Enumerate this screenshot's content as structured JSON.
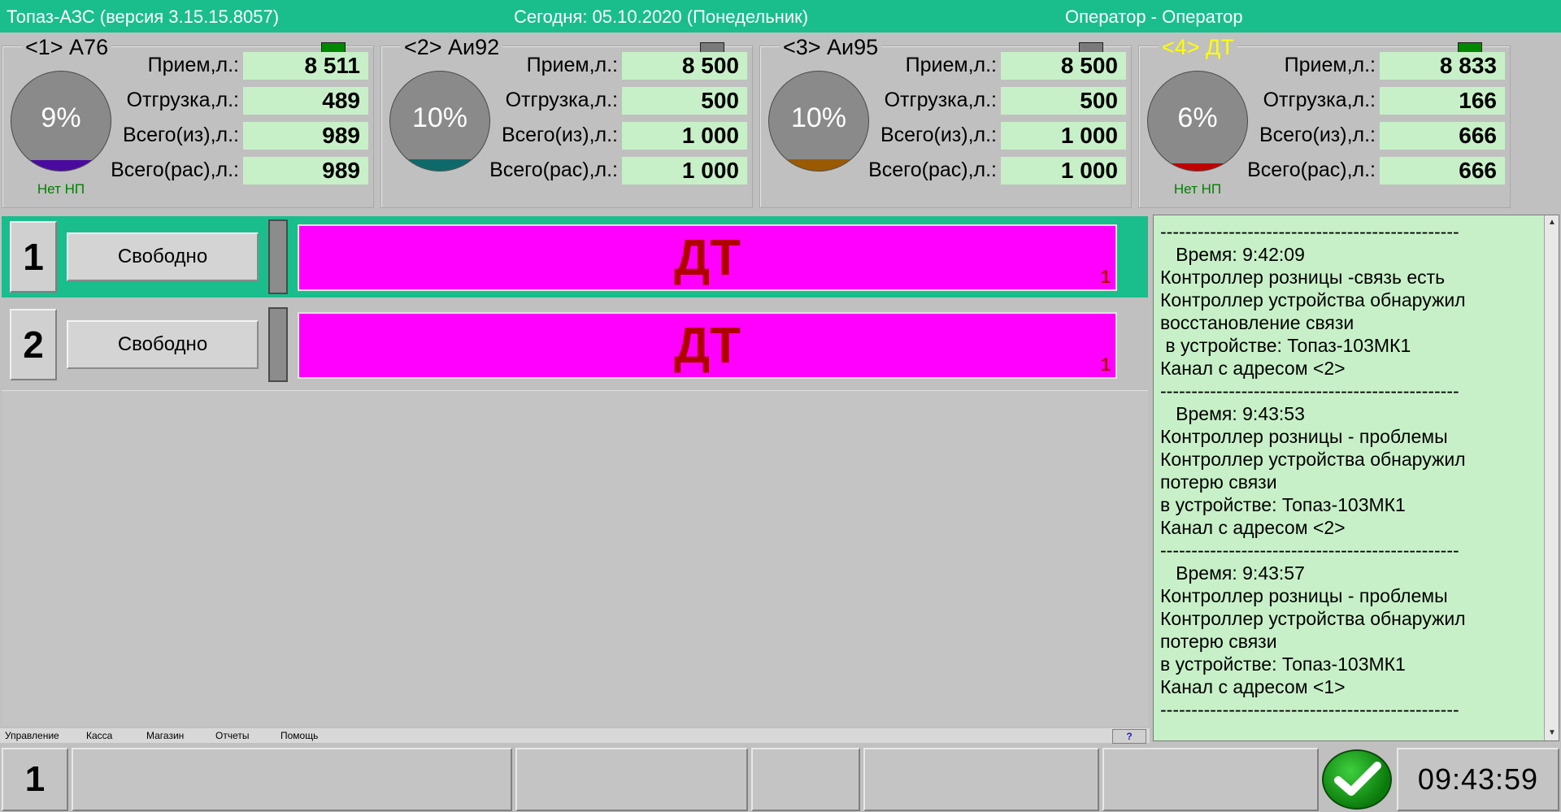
{
  "header": {
    "app": "Топаз-АЗС  (версия 3.15.15.8057)",
    "date": "Сегодня: 05.10.2020  (Понедельник)",
    "operator": "Оператор - Оператор"
  },
  "tanks": [
    {
      "title": "<1> А76",
      "led_color": "#008800",
      "percent": "9%",
      "fill_fraction": 0.09,
      "fill_color": "#4a0aa0",
      "status": "Нет НП",
      "receipt_label": "Прием,л.:",
      "receipt": "8 511",
      "shipment_label": "Отгрузка,л.:",
      "shipment": "489",
      "total_in_label": "Всего(из),л.:",
      "total_in": "989",
      "total_calc_label": "Всего(рас),л.:",
      "total_calc": "989"
    },
    {
      "title": "<2> Аи92",
      "led_color": "#7a7a7a",
      "percent": "10%",
      "fill_fraction": 0.1,
      "fill_color": "#0e6a6a",
      "status": "",
      "receipt_label": "Прием,л.:",
      "receipt": "8 500",
      "shipment_label": "Отгрузка,л.:",
      "shipment": "500",
      "total_in_label": "Всего(из),л.:",
      "total_in": "1 000",
      "total_calc_label": "Всего(рас),л.:",
      "total_calc": "1 000"
    },
    {
      "title": "<3> Аи95",
      "led_color": "#7a7a7a",
      "percent": "10%",
      "fill_fraction": 0.1,
      "fill_color": "#9a5a00",
      "status": "",
      "receipt_label": "Прием,л.:",
      "receipt": "8 500",
      "shipment_label": "Отгрузка,л.:",
      "shipment": "500",
      "total_in_label": "Всего(из),л.:",
      "total_in": "1 000",
      "total_calc_label": "Всего(рас),л.:",
      "total_calc": "1 000"
    },
    {
      "title": "<4> ДТ",
      "led_color": "#008800",
      "percent": "6%",
      "fill_fraction": 0.06,
      "fill_color": "#c00000",
      "status": "Нет НП",
      "receipt_label": "Прием,л.:",
      "receipt": "8 833",
      "shipment_label": "Отгрузка,л.:",
      "shipment": "166",
      "total_in_label": "Всего(из),л.:",
      "total_in": "666",
      "total_calc_label": "Всего(рас),л.:",
      "total_calc": "666"
    }
  ],
  "pumps": [
    {
      "number": "1",
      "state": "Свободно",
      "fuel": "ДТ",
      "nozzle": "1"
    },
    {
      "number": "2",
      "state": "Свободно",
      "fuel": "ДТ",
      "nozzle": "1"
    }
  ],
  "log": {
    "text": "------------------------------------------------\n   Время: 9:42:09\nКонтроллер розницы -связь есть\nКонтроллер устройства обнаружил\nвосстановление связи\n в устройстве: Топаз-103МК1\nКанал с адресом <2>\n------------------------------------------------\n   Время: 9:43:53\nКонтроллер розницы - проблемы\nКонтроллер устройства обнаружил\nпотерю связи\nв устройстве: Топаз-103МК1\nКанал с адресом <2>\n------------------------------------------------\n   Время: 9:43:57\nКонтроллер розницы - проблемы\nКонтроллер устройства обнаружил\nпотерю связи\nв устройстве: Топаз-103МК1\nКанал с адресом <1>\n------------------------------------------------"
  },
  "menu": {
    "items": [
      "Управление",
      "Касса",
      "Магазин",
      "Отчеты",
      "Помощь"
    ],
    "help": "?"
  },
  "bottom": {
    "number": "1",
    "clock": "09:43:59"
  }
}
